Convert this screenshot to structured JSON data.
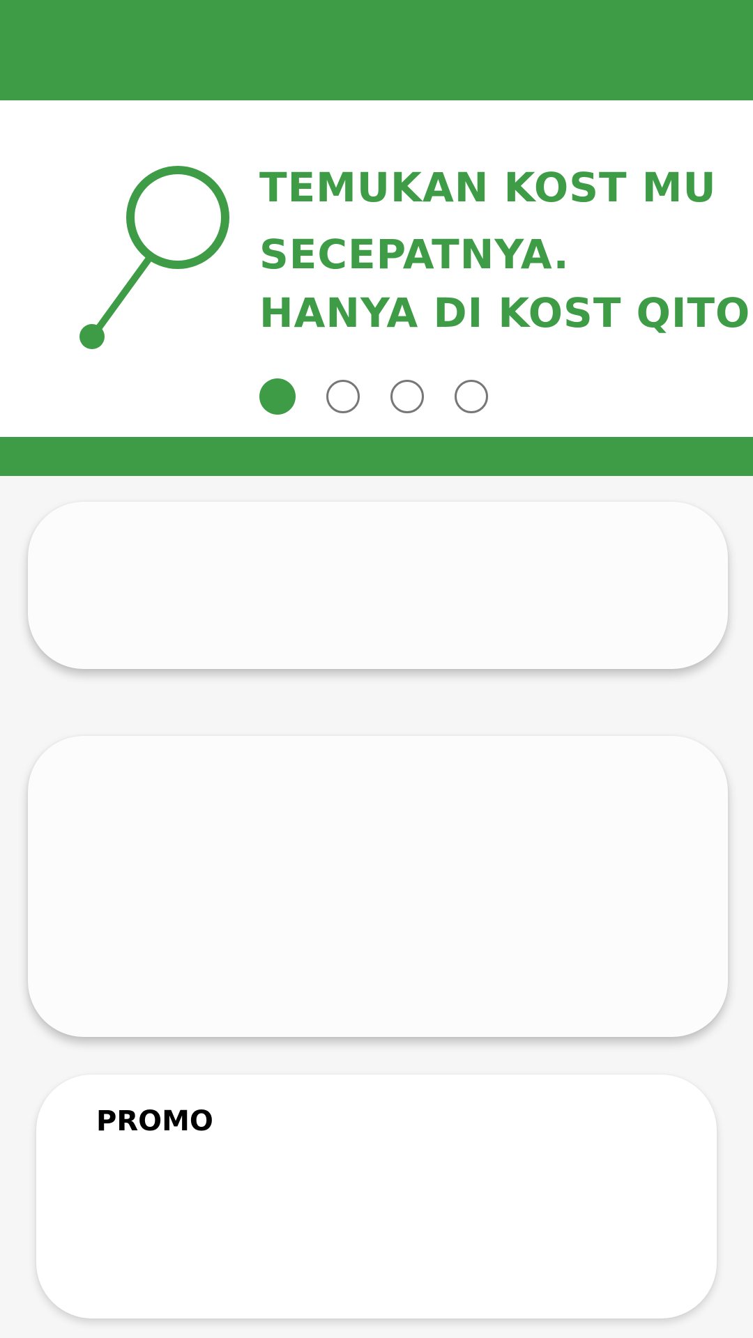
{
  "colors": {
    "brand_green": "#3d9c45",
    "dot_inactive": "#777777",
    "background": "#f6f6f6",
    "card": "#fcfcfc"
  },
  "banner": {
    "icon": "magnifier-icon",
    "headline": {
      "line1": "TEMUKAN KOST MU",
      "line2": "SECEPATNYA.",
      "line3": "HANYA DI KOST QITO"
    },
    "carousel": {
      "total_slides": 4,
      "active_index": 1
    }
  },
  "promo": {
    "title": "PROMO"
  }
}
